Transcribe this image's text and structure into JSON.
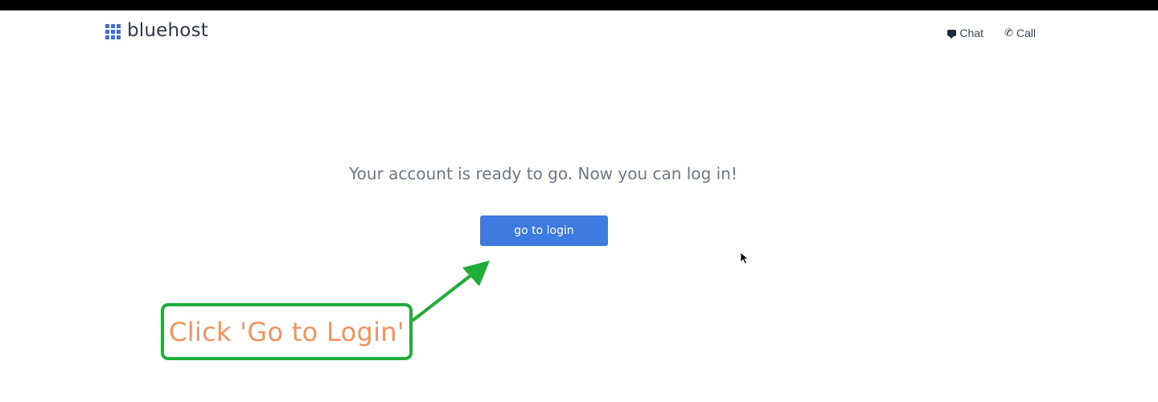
{
  "header": {
    "logo_text": "bluehost",
    "nav": {
      "chat_label": "Chat",
      "call_label": "Call"
    }
  },
  "main": {
    "message": "Your account is ready to go. Now you can log in!",
    "login_button_label": "go to login"
  },
  "annotation": {
    "callout_text": "Click 'Go to Login'",
    "callout_border_color": "#1fae38",
    "callout_text_color": "#f2925c"
  },
  "colors": {
    "brand_blue": "#3a6fd8",
    "button_blue": "#3e7be0"
  }
}
